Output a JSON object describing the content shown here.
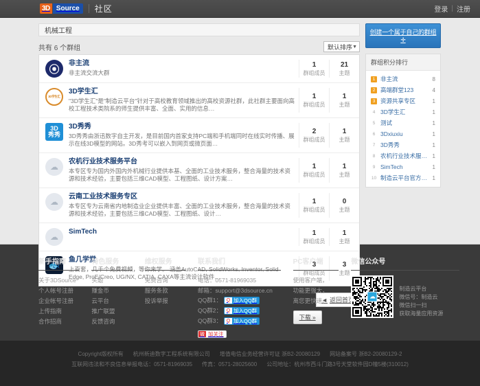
{
  "topbar": {
    "logo_3d": "3D",
    "logo_source": "Source",
    "site_sub": "社区",
    "login": "登录",
    "separator": "|",
    "register": "注册"
  },
  "breadcrumb": {
    "current": "机械工程"
  },
  "list_toolbar": {
    "count_text": "共有 6 个群组",
    "sort_label": "默认排序",
    "sort_caret": "▼"
  },
  "stat_labels": {
    "members": "群组成员",
    "topics": "主题"
  },
  "groups": [
    {
      "name": "非主流",
      "desc": "非主流交流大群",
      "members": "1",
      "topics": "21",
      "avatar_class": "av-fzl",
      "avatar_text": "⦿",
      "avatar_name": "group-avatar-feizhuliu"
    },
    {
      "name": "3D学生汇",
      "desc": "\"3D学生汇\"是\"制造云平台\"针对于高校教育领域推出的高校资源社群，此社群主要面向高校工程技术类院系的师生提供丰富、全面、实用的信息…",
      "members": "1",
      "topics": "1",
      "avatar_class": "av-3dxsh",
      "avatar_text": "3D学生汇",
      "avatar_name": "group-avatar-3dxueshenghui"
    },
    {
      "name": "3D秀秀",
      "desc": "3D秀秀由浙迅数字自主开发，是目前国内首家支持PC端和手机端同时在线实时传播、展示在线3D模型的网站。3D秀考可以嵌入到网页或微页面…",
      "members": "2",
      "topics": "1",
      "avatar_class": "av-3dxx",
      "avatar_text": "3D",
      "avatar_text2": "秀秀",
      "avatar_name": "group-avatar-3dxiuxiu"
    },
    {
      "name": "农机行业技术服务平台",
      "desc": "本专区专为国内外国内外机械行业提供本基、全面的工业技术服务，整合海量的技术资源和技术经验，主要包括三维CAD模型、工程图纸、设计方案…",
      "members": "1",
      "topics": "1",
      "avatar_class": "av-gray",
      "avatar_text": "☁",
      "avatar_name": "group-avatar-nongji"
    },
    {
      "name": "云南工业技术服务专区",
      "desc": "本专区专为云南省内地制造业企业提供丰富、全面的工业技术服务，整合海量的技术资源和技术经验，主要包括三维CAD模型、工程图纸、设计…",
      "members": "1",
      "topics": "0",
      "avatar_class": "av-gray",
      "avatar_text": "☁",
      "avatar_name": "group-avatar-yunnan"
    },
    {
      "name": "SimTech",
      "desc": "",
      "members": "1",
      "topics": "1",
      "avatar_class": "av-gray",
      "avatar_text": "☁",
      "avatar_name": "group-avatar-simtech"
    },
    {
      "name": "鱼几学堂",
      "desc": "上百套，几千个免费视频，等你来学。\n涵盖AutoCAD, SolidWorks, Inventor, Solid Edge, ProE/Creo, UG/NX, CATIA, CAXA等主流设计软件…",
      "members": "3",
      "topics": "3",
      "avatar_class": "av-fish",
      "avatar_text": "🐟",
      "avatar_name": "group-avatar-yujixuetang"
    }
  ],
  "pager": {
    "back_icon": "◄",
    "back_label": "返回首页"
  },
  "sidebar": {
    "create_button": "创建一个属于自己的群组 ✛",
    "rank_panel_title": "群组积分排行",
    "rank_items": [
      {
        "no": "1",
        "name": "非主流",
        "value": "8",
        "highlight": true
      },
      {
        "no": "2",
        "name": "高端群堂123",
        "value": "4",
        "highlight": true
      },
      {
        "no": "3",
        "name": "资源共享专区",
        "value": "1",
        "highlight": true
      },
      {
        "no": "4",
        "name": "3D学生汇",
        "value": "1",
        "highlight": false
      },
      {
        "no": "5",
        "name": "测试",
        "value": "1",
        "highlight": false
      },
      {
        "no": "6",
        "name": "3Dxiuxiu",
        "value": "1",
        "highlight": false
      },
      {
        "no": "7",
        "name": "3D秀秀",
        "value": "1",
        "highlight": false
      },
      {
        "no": "8",
        "name": "农机行业技术服务平台",
        "value": "1",
        "highlight": false
      },
      {
        "no": "9",
        "name": "SimTech",
        "value": "1",
        "highlight": false
      },
      {
        "no": "10",
        "name": "制造云平台官方客服群",
        "value": "1",
        "highlight": false
      }
    ]
  },
  "footer": {
    "col_newbie": {
      "title": "新手指南",
      "links": [
        "关于3DSource",
        "个人帐号注册",
        "企业帐号注册",
        "上传指南",
        "合作招商"
      ]
    },
    "col_service": {
      "title": "特色服务",
      "links": [
        "头题",
        "赚金币",
        "云平台",
        "推广联盟",
        "反馈咨询"
      ]
    },
    "col_rights": {
      "title": "维权服务",
      "links": [
        "免费咨询",
        "服务条款",
        "投诉举报"
      ]
    },
    "col_contact": {
      "title": "联系我们",
      "phone": "电话：0571-81969035",
      "email": "邮箱：support@3dsource.cn",
      "qq_rows": [
        {
          "label": "QQ群1：",
          "btn": "加入QQ群"
        },
        {
          "label": "QQ群2：",
          "btn": "加入QQ群"
        },
        {
          "label": "QQ群3：",
          "btn": "加入QQ群"
        }
      ],
      "weibo_btn": "加关注"
    },
    "col_pc": {
      "title": "PC客户端",
      "lines": [
        "使用客户端，",
        "功能更强大，",
        "离您更快速。"
      ],
      "download_btn": "下载 »"
    },
    "col_wechat": {
      "title": "微信公众号",
      "qr_logo": "☁",
      "lines": [
        "制造云平台",
        "微信号：制造云",
        "微信扫一扫",
        "获取海量应用资源"
      ]
    }
  },
  "copyright": {
    "line1": [
      "Copyright版权所有",
      "杭州新迪数字工程系统有限公司",
      "增值电信业务经营许可证 浙B2-20080129",
      "网站备案号 浙B2-20080129-2"
    ],
    "line2": [
      "互联网违法和不良信息举报电话：0571-81969035",
      "传真：0571-28025600",
      "公司地址：杭州市西斗门路3号天堂软件园D幢5楼(310012)"
    ]
  }
}
